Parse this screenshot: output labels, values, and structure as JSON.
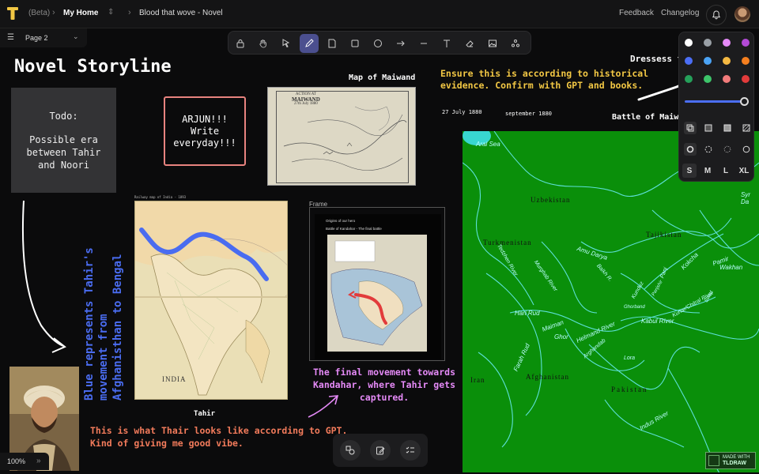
{
  "header": {
    "beta": "(Beta)",
    "home": "My Home",
    "doc_title": "Blood that wove - Novel",
    "feedback": "Feedback",
    "changelog": "Changelog"
  },
  "page_selector": {
    "label": "Page 2"
  },
  "toolbar": {
    "tools": [
      "lock-icon",
      "hand-icon",
      "select-icon",
      "pencil-icon",
      "note-icon",
      "rectangle-icon",
      "ellipse-icon",
      "arrow-icon",
      "line-icon",
      "text-icon",
      "eraser-icon",
      "image-icon",
      "more-icon"
    ],
    "active": "pencil-icon"
  },
  "style_panel": {
    "colors": [
      "#ffffff",
      "#9aa0a6",
      "#e58af7",
      "#b34ad6",
      "#4b6ef5",
      "#4ba3f5",
      "#f5b942",
      "#f57f1f",
      "#25a05a",
      "#3dc46a",
      "#f27b7b",
      "#e23b3b"
    ],
    "sizes": [
      "S",
      "M",
      "L",
      "XL"
    ],
    "active_size": "S",
    "opacity_label": "opacity"
  },
  "canvas": {
    "title": "Novel Storyline",
    "todo_note": [
      "Todo:",
      "",
      "Possible era",
      "between Tahir",
      "and Noori"
    ],
    "arjun_note": [
      "ARJUN!!!",
      "Write",
      "everyday!!!"
    ],
    "map_maiwand_title": "Map of Maiwand",
    "maiwand_map_header": [
      "ACTION AT",
      "MAIWAND",
      "27th July 1880"
    ],
    "historical_note": [
      "Ensure this is according to historical",
      "evidence. Confirm with GPT and books."
    ],
    "date1": "27 July 1880",
    "date2": "september 1880",
    "dress_label": "Dressess ti",
    "battle_label": "Battle of Maiw",
    "railway_label": "Railway map of India - 1893",
    "india_map_label": "INDIA",
    "tahir_caption": "Tahir",
    "frame_label": "Frame",
    "frame_lines": [
      "Origins of our hero",
      "Battle of Kandahar - The final battle"
    ],
    "vertical_text": [
      "Blue represents Tahir's",
      "movement from",
      "Afghanisthan to Bengal"
    ],
    "final_movement": [
      "The final movement towards",
      "Kandahar, where Tahir gets",
      "captured."
    ],
    "gpt_note": [
      "This is what Thair looks like according to GPT.",
      "Kind of giving me good vibe."
    ],
    "map_labels": [
      "Aral Sea",
      "Uzbekistan",
      "Tajikistan",
      "Turkmenistan",
      "Syr Da",
      "Amu Darya",
      "Tedzhen River",
      "Murghab River",
      "Balkh R.",
      "Kunduz",
      "Panj",
      "Kokcha",
      "Pamir",
      "Wakhan",
      "Hari Rud",
      "Maiman",
      "Ghor",
      "Helmand River",
      "Farah Rud",
      "Kabul River",
      "Kunar/Chitral River",
      "Swat",
      "Arghandab",
      "Lora",
      "Iran",
      "Afghanistan",
      "Pakistan",
      "Indus River",
      "Ghorband",
      "Panjshir"
    ],
    "made_with": [
      "MADE WITH",
      "TLDRAW"
    ]
  },
  "zoom": {
    "level": "100%"
  }
}
